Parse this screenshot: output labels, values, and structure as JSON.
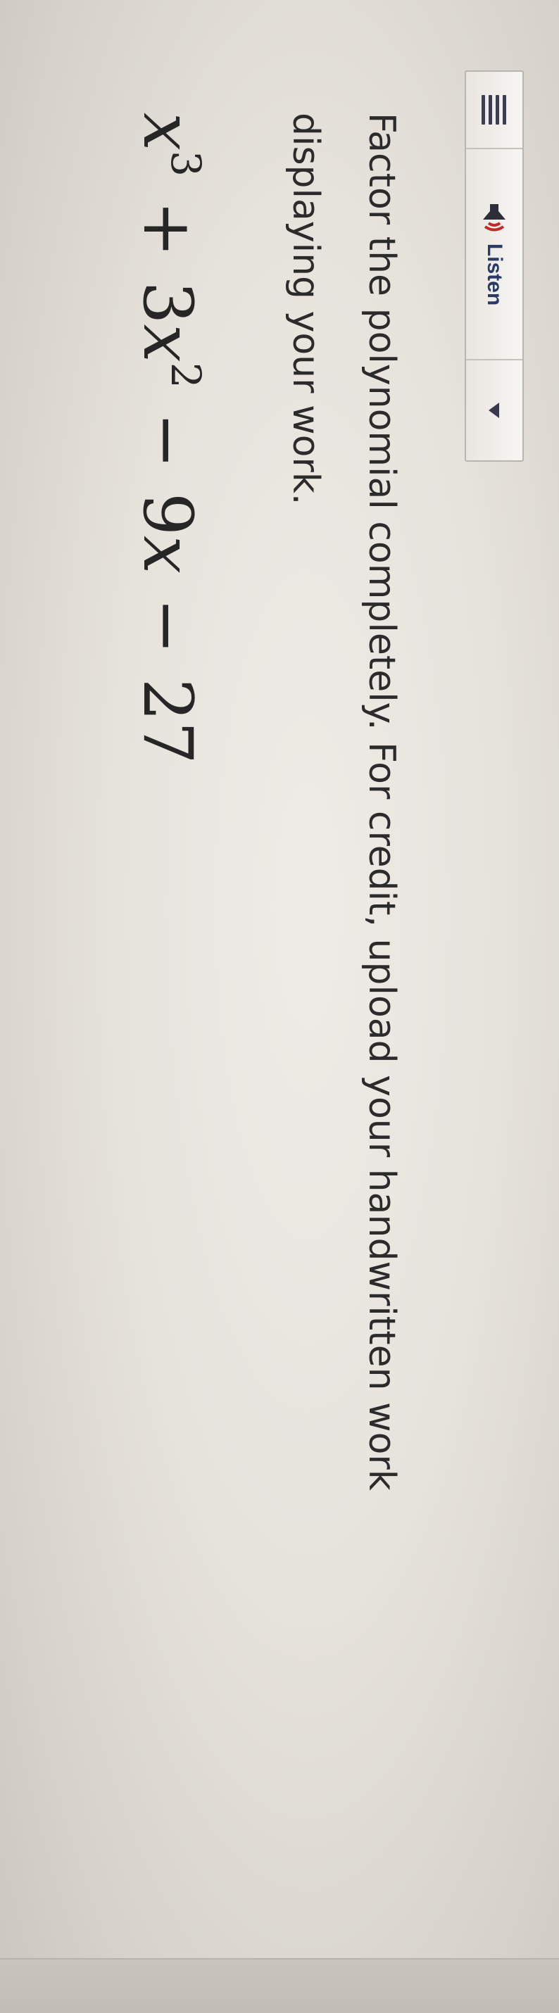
{
  "toolbar": {
    "menu_icon": "menu-icon",
    "listen_icon": "speaker-icon",
    "listen_label": "Listen",
    "dropdown_icon": "caret-down-icon"
  },
  "question": {
    "prompt": "Factor the polynomial completely. For credit, upload your handwritten work displaying your work.",
    "equation": {
      "var": "x",
      "exp1": "3",
      "op1": "+",
      "coef2": "3",
      "exp2": "2",
      "op2": "−",
      "coef3": "9",
      "op3": "−",
      "const": "27"
    }
  },
  "colors": {
    "accent": "#c22a2a",
    "listen_text": "#2a3a66",
    "text": "#2b2b2b"
  }
}
